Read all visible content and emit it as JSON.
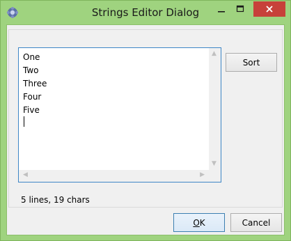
{
  "window": {
    "title": "Strings Editor Dialog"
  },
  "editor": {
    "lines": [
      "One",
      "Two",
      "Three",
      "Four",
      "Five"
    ]
  },
  "buttons": {
    "sort": "Sort",
    "ok_mnemonic": "O",
    "ok_rest": "K",
    "cancel": "Cancel"
  },
  "status": {
    "text": "5 lines, 19 chars"
  },
  "colors": {
    "frame": "#9fd37f",
    "close_button": "#c7413a",
    "editor_border": "#3d86c6"
  },
  "icons": {
    "app": "qt-designer-icon",
    "minimize": "minimize-icon",
    "maximize": "maximize-icon",
    "close": "close-icon"
  }
}
